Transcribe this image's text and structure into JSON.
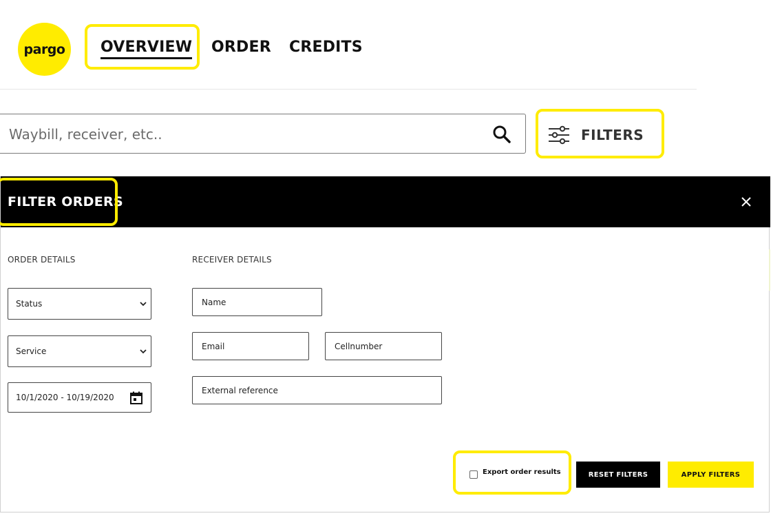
{
  "brand": {
    "logo_text": "pargo",
    "accent_color": "#ffec00"
  },
  "nav": {
    "items": [
      "OVERVIEW",
      "ORDER",
      "CREDITS"
    ],
    "active": "OVERVIEW"
  },
  "search": {
    "placeholder": "Waybill, receiver, etc..",
    "icon": "search-icon"
  },
  "filters_button": {
    "label": "FILTERS",
    "icon": "sliders-icon"
  },
  "modal": {
    "title": "FILTER ORDERS",
    "close_icon": "close-icon",
    "order_details": {
      "label": "ORDER DETAILS",
      "status_select": "Status",
      "service_select": "Service",
      "date_range": "10/1/2020 - 10/19/2020"
    },
    "receiver_details": {
      "label": "RECEIVER DETAILS",
      "name_placeholder": "Name",
      "email_placeholder": "Email",
      "cell_placeholder": "Cellnumber",
      "external_placeholder": "External reference"
    },
    "export_label": "Export order results",
    "export_checked": false,
    "reset_label": "RESET FILTERS",
    "apply_label": "APPLY FILTERS"
  }
}
